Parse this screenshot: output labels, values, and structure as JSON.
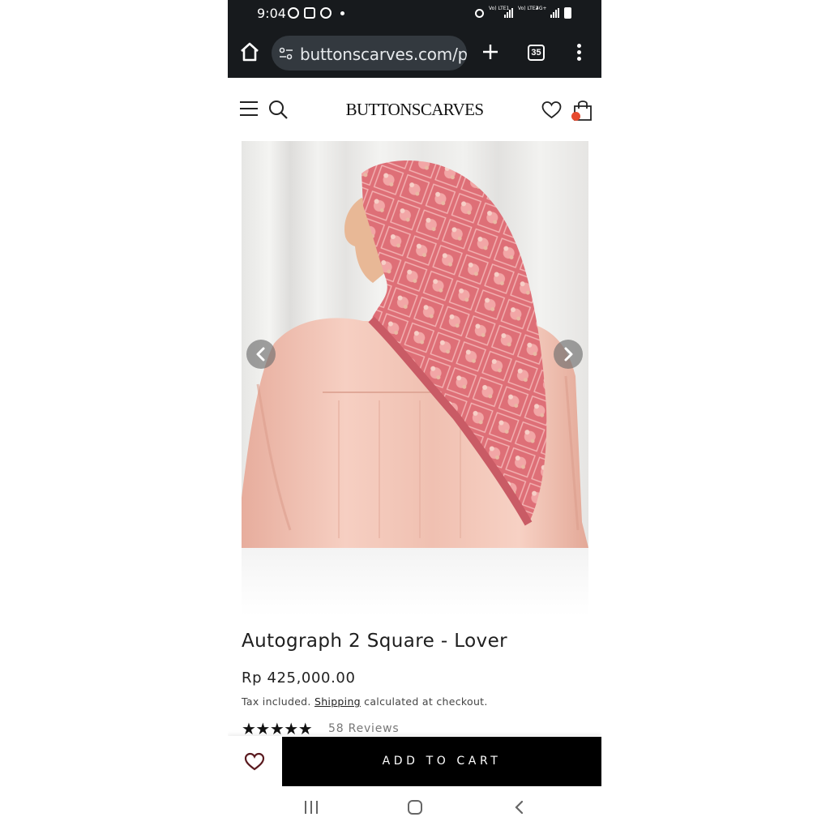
{
  "status_bar": {
    "time": "9:04",
    "sim1_label": "Vo) LTE1",
    "sim2_label": "Vo) LTE2",
    "network": "4G+"
  },
  "browser": {
    "url": "buttonscarves.com/pr",
    "tab_count": "35"
  },
  "site": {
    "logo": "BUTTONSCARVES"
  },
  "product": {
    "image_alt": "Model wearing pink patterned square hijab",
    "title": "Autograph 2 Square - Lover",
    "price": "Rp 425,000.00",
    "tax_prefix": "Tax included. ",
    "shipping_link": "Shipping",
    "tax_suffix": " calculated at checkout.",
    "stars": "★★★★★",
    "reviews": "58 Reviews",
    "rating": 5
  },
  "sticky": {
    "add_to_cart": "ADD TO CART"
  },
  "colors": {
    "dark_bar": "#171a1d",
    "cart_badge": "#e64a2e",
    "scarf": "#e0737a",
    "dress": "#f1c3b4"
  }
}
